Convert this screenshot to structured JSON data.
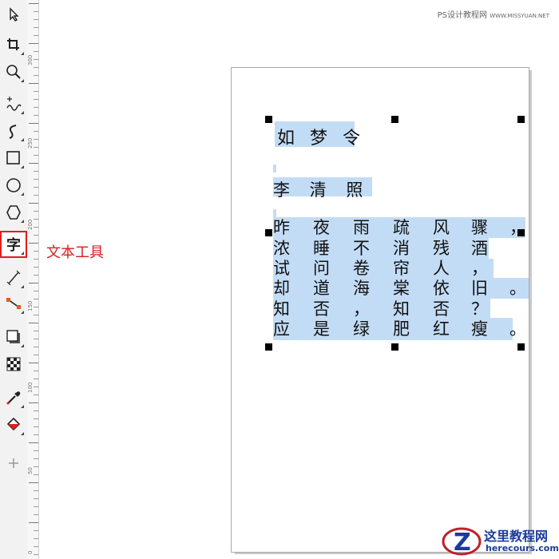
{
  "watermark_top": {
    "brand": "PS设计教程网",
    "url": "WWW.MISSYUAN.NET"
  },
  "callout": {
    "label": "文本工具"
  },
  "toolbox": {
    "tools": [
      {
        "name": "pick-tool",
        "icon": "pointer-icon"
      },
      {
        "name": "crop-tool",
        "icon": "crop-icon"
      },
      {
        "name": "zoom-tool",
        "icon": "magnifier-icon"
      },
      {
        "name": "freehand-tool",
        "icon": "freehand-icon"
      },
      {
        "name": "artistic-media-tool",
        "icon": "curve-icon"
      },
      {
        "name": "rectangle-tool",
        "icon": "rectangle-icon"
      },
      {
        "name": "ellipse-tool",
        "icon": "ellipse-icon"
      },
      {
        "name": "polygon-tool",
        "icon": "polygon-icon"
      },
      {
        "name": "text-tool",
        "icon": "text-icon",
        "glyph": "字",
        "active": true
      },
      {
        "name": "dimension-tool",
        "icon": "line-icon"
      },
      {
        "name": "connector-tool",
        "icon": "connector-icon"
      },
      {
        "name": "drop-shadow-tool",
        "icon": "shadow-icon"
      },
      {
        "name": "transparency-tool",
        "icon": "checker-icon"
      },
      {
        "name": "eyedropper-tool",
        "icon": "eyedropper-icon"
      },
      {
        "name": "fill-tool",
        "icon": "bucket-icon"
      },
      {
        "name": "add-tool",
        "icon": "plus-icon"
      }
    ]
  },
  "ruler": {
    "labels": [
      "300",
      "250",
      "200",
      "150",
      "100",
      "50",
      "0"
    ]
  },
  "document": {
    "title": "如 梦 令",
    "author": "李 清 照",
    "poem_rows": [
      [
        "昨",
        "夜",
        "雨",
        "疏",
        "风",
        "骤",
        "，"
      ],
      [
        "浓",
        "睡",
        "不",
        "消",
        "残",
        "酒",
        ""
      ],
      [
        "试",
        "问",
        "卷",
        "帘",
        "人",
        "，",
        ""
      ],
      [
        "却",
        "道",
        "海",
        "棠",
        "依",
        "旧",
        "。"
      ],
      [
        "知",
        "否",
        "，",
        "知",
        "否",
        "？",
        ""
      ],
      [
        "应",
        "是",
        "绿",
        "肥",
        "红",
        "瘦",
        "。"
      ]
    ]
  },
  "logo": {
    "name": "这里教程网",
    "url": "herecours.com",
    "mark": "Z"
  },
  "colors": {
    "highlight": "#c3dcf5",
    "callout": "#d42020",
    "active_outline": "#e02020"
  }
}
